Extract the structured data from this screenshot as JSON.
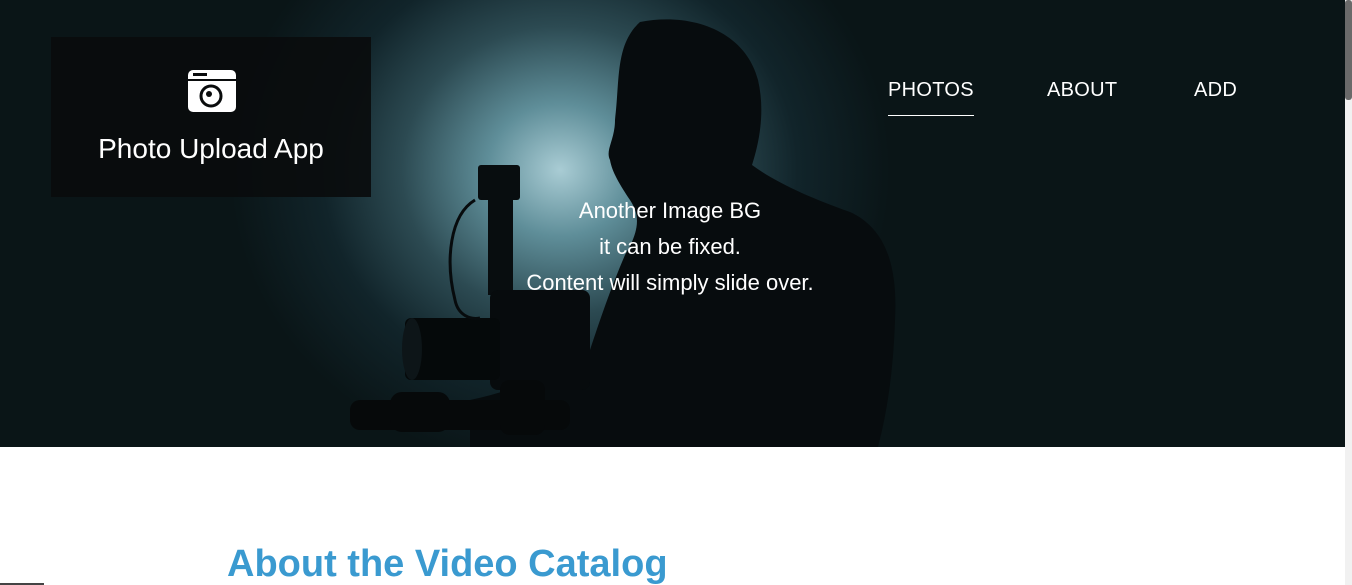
{
  "header": {
    "logo_icon": "camera-folder-icon",
    "app_title": "Photo Upload App"
  },
  "nav": {
    "items": [
      {
        "label": "PHOTOS",
        "active": true
      },
      {
        "label": "ABOUT",
        "active": false
      },
      {
        "label": "ADD",
        "active": false
      }
    ]
  },
  "hero": {
    "lines": [
      "Another Image BG",
      "it can be fixed.",
      "Content will simply slide over."
    ]
  },
  "main": {
    "section_title": "About the Video Catalog"
  },
  "colors": {
    "accent": "#3a9ad0",
    "logo_bg": "#0a0c0d",
    "hero_glow": "#a9ccd4"
  }
}
